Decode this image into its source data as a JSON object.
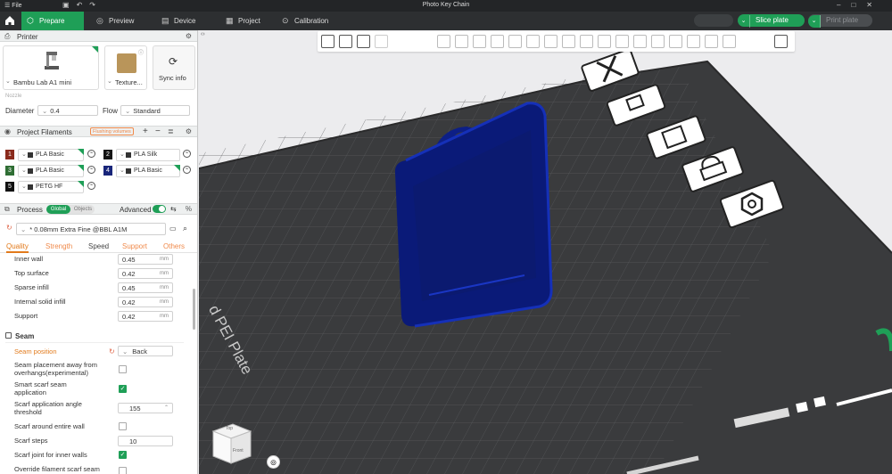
{
  "titlebar": {
    "file_label": "File",
    "title": "Photo Key Chain"
  },
  "nav": {
    "tabs": [
      {
        "label": "Prepare",
        "icon": "prepare-icon"
      },
      {
        "label": "Preview",
        "icon": "preview-icon"
      },
      {
        "label": "Device",
        "icon": "device-icon"
      },
      {
        "label": "Project",
        "icon": "project-icon"
      },
      {
        "label": "Calibration",
        "icon": "calibration-icon"
      }
    ],
    "slice_label": "Slice plate",
    "print_label": "Print plate"
  },
  "printer": {
    "section_title": "Printer",
    "printer_name": "Bambu Lab A1 mini",
    "plate_name": "Texture...",
    "sync_label": "Sync info",
    "nozzle_label": "Nozzle",
    "diameter_label": "Diameter",
    "diameter_value": "0.4",
    "flow_label": "Flow",
    "flow_value": "Standard"
  },
  "filaments": {
    "section_title": "Project Filaments",
    "flushing_label": "Flushing volumes",
    "items": [
      {
        "num": "1",
        "name": "PLA Basic",
        "color": "#8a2a1c"
      },
      {
        "num": "2",
        "name": "PLA Silk",
        "color": "#151515"
      },
      {
        "num": "3",
        "name": "PLA Basic",
        "color": "#2f6e34"
      },
      {
        "num": "4",
        "name": "PLA Basic",
        "color": "#18257a"
      },
      {
        "num": "5",
        "name": "PETG HF",
        "color": "#111111"
      }
    ]
  },
  "process": {
    "section_title": "Process",
    "toggle_global": "Global",
    "toggle_objects": "Objects",
    "advanced_label": "Advanced",
    "preset": "* 0.08mm Extra Fine @BBL A1M",
    "tabs": [
      "Quality",
      "Strength",
      "Speed",
      "Support",
      "Others"
    ],
    "rows": [
      {
        "label": "Inner wall",
        "value": "0.45",
        "unit": "mm"
      },
      {
        "label": "Top surface",
        "value": "0.42",
        "unit": "mm"
      },
      {
        "label": "Sparse infill",
        "value": "0.45",
        "unit": "mm"
      },
      {
        "label": "Internal solid infill",
        "value": "0.42",
        "unit": "mm"
      },
      {
        "label": "Support",
        "value": "0.42",
        "unit": "mm"
      }
    ],
    "seam": {
      "title": "Seam",
      "position_label": "Seam position",
      "position_value": "Back",
      "away_label_1": "Seam placement away from",
      "away_label_2": "overhangs(experimental)",
      "smart_label_1": "Smart scarf seam",
      "smart_label_2": "application",
      "angle_label_1": "Scarf application angle",
      "angle_label_2": "threshold",
      "angle_value": "155",
      "around_label": "Scarf around entire wall",
      "steps_label": "Scarf steps",
      "steps_value": "10",
      "inner_label": "Scarf joint for inner walls",
      "override_label": "Override filament scarf seam"
    }
  },
  "plate": {
    "bed_text": "d PEI Plate"
  },
  "viewcube": {
    "top": "Top",
    "front": "Front"
  },
  "colors": {
    "accent": "#1f9f57",
    "model": "#0d1f86",
    "bed": "#3c3d3f"
  }
}
